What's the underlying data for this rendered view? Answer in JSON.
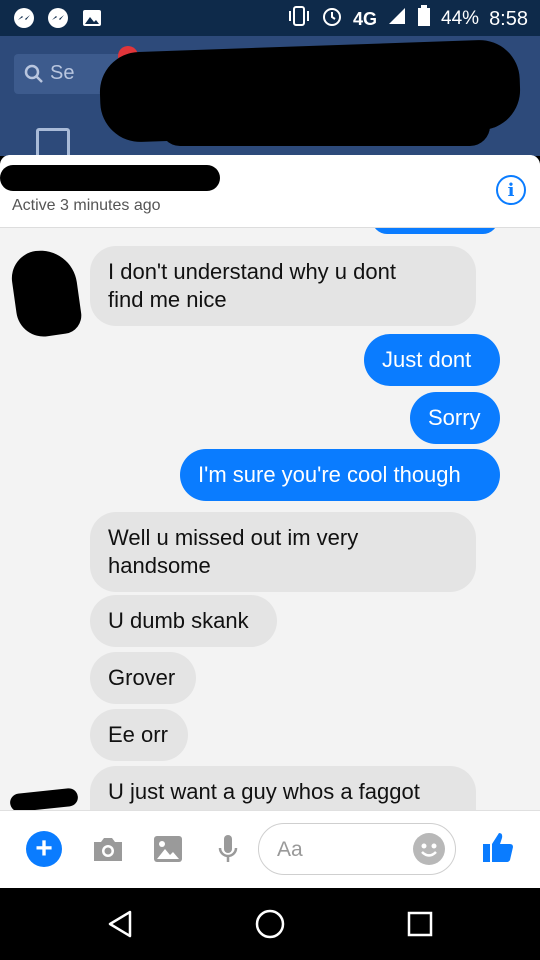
{
  "status_bar": {
    "network": "4G",
    "battery": "44%",
    "time": "8:58"
  },
  "background": {
    "search_placeholder": "Se"
  },
  "header": {
    "status": "Active 3 minutes ago"
  },
  "messages": [
    {
      "side": "in",
      "text": "I don't understand why u dont\nfind me nice"
    },
    {
      "side": "out",
      "text": "Just dont"
    },
    {
      "side": "out",
      "text": "Sorry"
    },
    {
      "side": "out",
      "text": "I'm sure you're cool though"
    },
    {
      "side": "in",
      "text": "Well u missed out im very\nhandsome"
    },
    {
      "side": "in",
      "text": "U dumb skank"
    },
    {
      "side": "in",
      "text": "Grover"
    },
    {
      "side": "in",
      "text": "Ee orr"
    },
    {
      "side": "in",
      "text": "U just want a guy whos a faggot"
    }
  ],
  "composer": {
    "placeholder": "Aa"
  },
  "colors": {
    "accent": "#0a7cff",
    "incoming_bubble": "#e4e4e4"
  }
}
